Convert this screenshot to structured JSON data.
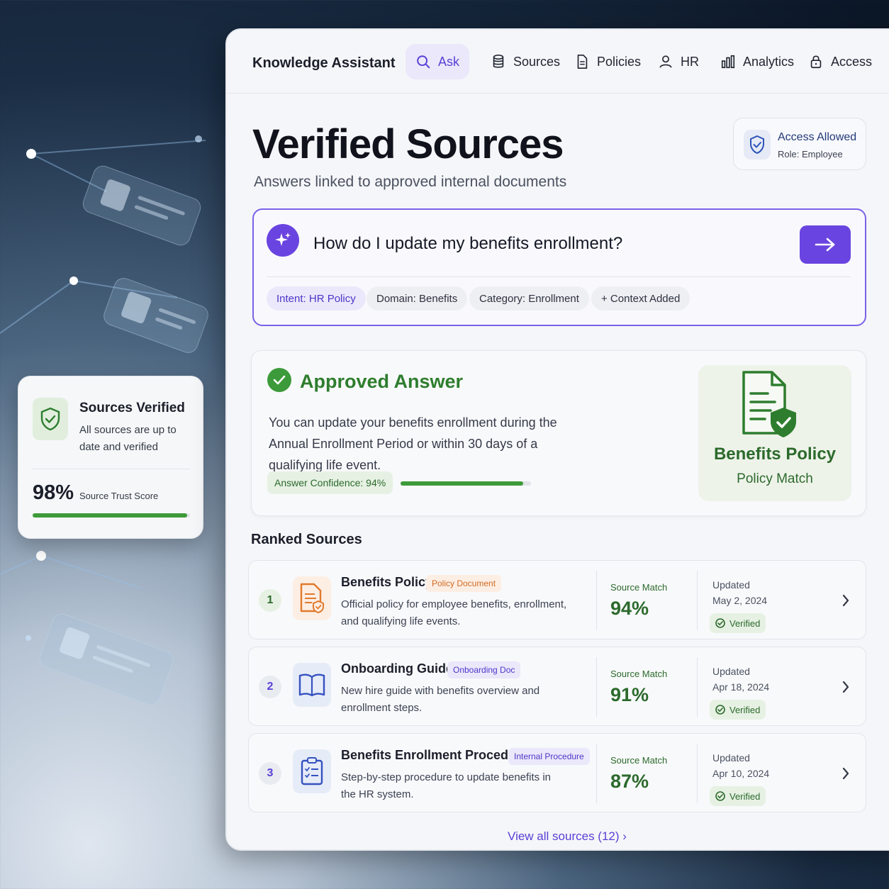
{
  "floating_card": {
    "title": "Sources Verified",
    "subtitle": "All sources are up to date and verified",
    "score": "98%",
    "score_label": "Source Trust Score",
    "score_fraction": 0.98
  },
  "nav": {
    "brand": "Knowledge Assistant",
    "items": [
      {
        "label": "Ask",
        "icon": "search-icon",
        "active": true
      },
      {
        "label": "Sources",
        "icon": "database-icon"
      },
      {
        "label": "Policies",
        "icon": "document-icon"
      },
      {
        "label": "HR",
        "icon": "user-icon"
      },
      {
        "label": "Analytics",
        "icon": "bar-chart-icon"
      },
      {
        "label": "Access",
        "icon": "lock-icon"
      }
    ]
  },
  "header": {
    "title": "Verified Sources",
    "subtitle": "Answers linked to approved internal documents"
  },
  "access": {
    "title": "Access Allowed",
    "role": "Role: Employee"
  },
  "query": {
    "text": "How do I update my benefits enrollment?",
    "chips": [
      "Intent: HR Policy",
      "Domain: Benefits",
      "Category: Enrollment",
      "+ Context Added"
    ]
  },
  "answer": {
    "title": "Approved Answer",
    "body": "You can update your benefits enrollment during the Annual Enrollment Period or within 30 days of a qualifying life event.",
    "confidence_label": "Answer Confidence: 94%",
    "confidence_fraction": 0.94,
    "match_title": "Benefits Policy",
    "match_subtitle": "Policy Match"
  },
  "ranked": {
    "title": "Ranked Sources",
    "match_label": "Source Match",
    "updated_label": "Updated",
    "verified_label": "Verified",
    "sources": [
      {
        "rank": "1",
        "title": "Benefits Policy",
        "tag": "Policy Document",
        "desc": "Official policy for employee benefits, enrollment, and qualifying life events.",
        "match": "94%",
        "date": "May 2, 2024"
      },
      {
        "rank": "2",
        "title": "Onboarding Guide",
        "tag": "Onboarding Doc",
        "desc": "New hire guide with benefits overview and enrollment steps.",
        "match": "91%",
        "date": "Apr 18, 2024"
      },
      {
        "rank": "3",
        "title": "Benefits Enrollment Procedure",
        "tag": "Internal Procedure",
        "desc": "Step-by-step procedure to update benefits in the HR system.",
        "match": "87%",
        "date": "Apr 10, 2024"
      }
    ],
    "view_all": "View all sources (12)"
  },
  "colors": {
    "accent": "#6a44e0",
    "success": "#3e9b3a",
    "orange": "#d26b22"
  }
}
